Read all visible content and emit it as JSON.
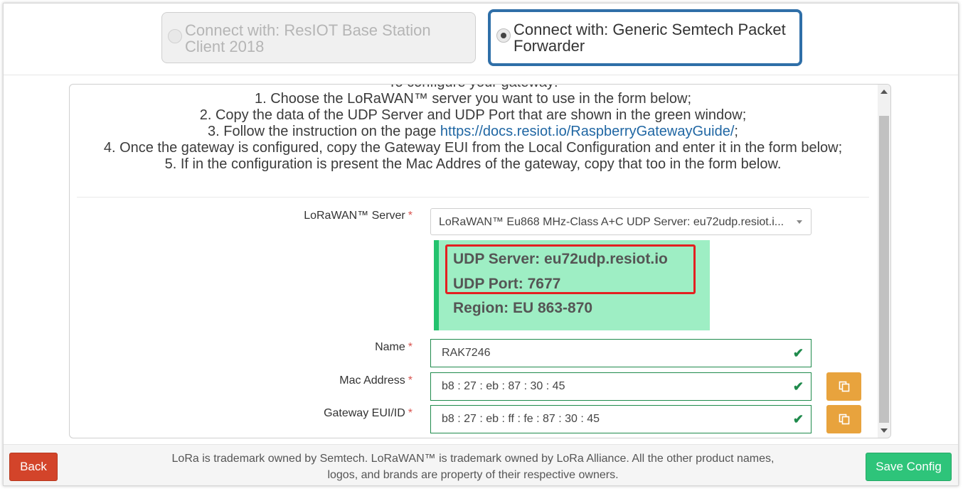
{
  "options": {
    "resiot_label": "Connect with: ResIOT Base Station Client 2018",
    "semtech_label": "Connect with: Generic Semtech Packet Forwarder"
  },
  "instructions": {
    "heading": "To configure your gateway:",
    "step1": "1. Choose the LoRaWAN™ server you want to use in the form below;",
    "step2": "2. Copy the data of the UDP Server and UDP Port that are shown in the green window;",
    "step3_prefix": "3. Follow the instruction on the page ",
    "step3_link": "https://docs.resiot.io/RaspberryGatewayGuide/",
    "step3_suffix": ";",
    "step4": "4. Once the gateway is configured, copy the Gateway EUI from the Local Configuration and enter it in the form below;",
    "step5": "5. If in the configuration is present the Mac Addres of the gateway, copy that too in the form below."
  },
  "form": {
    "server_label": "LoRaWAN™ Server",
    "server_value": "LoRaWAN™ Eu868 MHz-Class A+C UDP Server: eu72udp.resiot.i...",
    "name_label": "Name",
    "name_value": "RAK7246",
    "mac_label": "Mac Address",
    "mac_value": "b8 : 27 : eb : 87 : 30 : 45",
    "eui_label": "Gateway EUI/ID",
    "eui_value": "b8 : 27 : eb : ff : fe : 87 : 30 : 45",
    "required_mark": "*",
    "check_mark": "✔"
  },
  "udp": {
    "server": "UDP Server: eu72udp.resiot.io",
    "port": "UDP Port: 7677",
    "region": "Region: EU 863-870"
  },
  "footer": {
    "back_label": "Back",
    "save_label": "Save Config",
    "trademark_text": "LoRa is trademark owned by Semtech. LoRaWAN™ is trademark owned by LoRa Alliance. All the other product names, logos, and brands are property of their respective owners."
  },
  "colors": {
    "selected_border": "#2f6fa8",
    "udp_background": "#9eeec4",
    "udp_accent": "#23c36e",
    "highlight_red": "#e32020",
    "valid_green": "#1f8a4c",
    "copy_orange": "#e8a33d",
    "back_red": "#d3442a",
    "save_green": "#2ec47a"
  },
  "icons": {
    "copy": "copy-icon",
    "check": "check-icon",
    "select_arrow": "chevron-down-icon"
  }
}
